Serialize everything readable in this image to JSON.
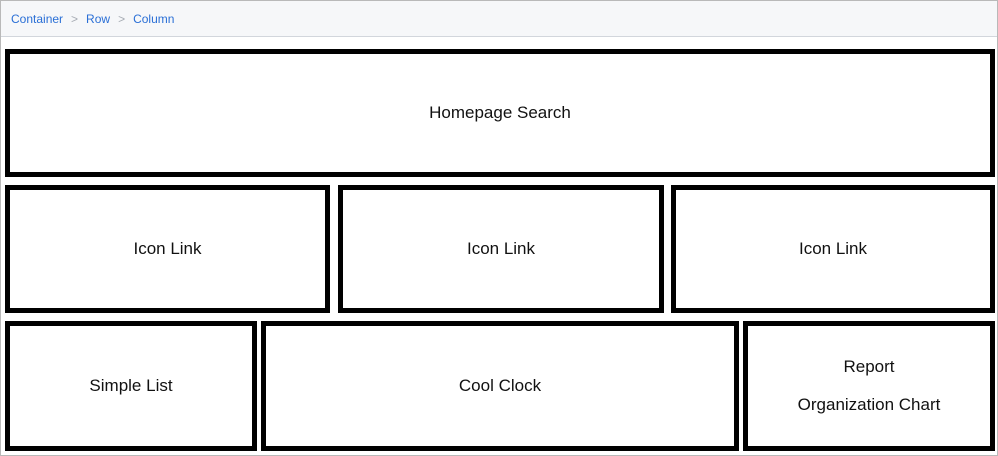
{
  "breadcrumb": {
    "items": [
      "Container",
      "Row",
      "Column"
    ],
    "separator": ">"
  },
  "layout": {
    "row1": {
      "search": "Homepage Search"
    },
    "row2": {
      "links": [
        "Icon Link",
        "Icon Link",
        "Icon Link"
      ]
    },
    "row3": {
      "simple_list": "Simple List",
      "cool_clock": "Cool Clock",
      "report_line1": "Report",
      "report_line2": "Organization Chart"
    }
  },
  "colors": {
    "link": "#2a6fd6",
    "border": "#000000",
    "bar_background": "#f6f7f9"
  }
}
